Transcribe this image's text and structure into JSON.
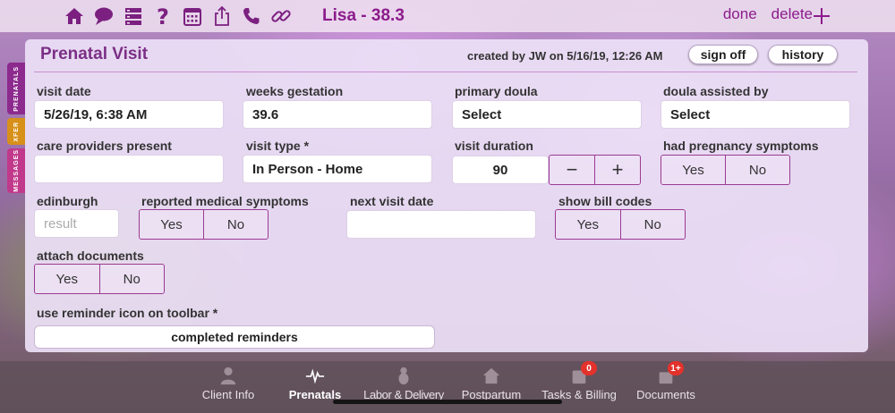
{
  "topbar": {
    "client_title": "Lisa - 38.3",
    "done_label": "done",
    "delete_label": "delete",
    "icons": [
      "home-icon",
      "chat-icon",
      "list-icon",
      "help-icon",
      "calendar-icon",
      "share-icon",
      "phone-icon",
      "link-icon",
      "plus-icon"
    ]
  },
  "side_tabs": [
    {
      "label": "PRENATALS",
      "color": "#8c2a8e"
    },
    {
      "label": "XFER",
      "color": "#d7901a"
    },
    {
      "label": "MESSAGES",
      "color": "#c1398b"
    }
  ],
  "panel": {
    "title": "Prenatal Visit",
    "created_by": "created by JW on 5/16/19, 12:26 AM",
    "sign_off_label": "sign off",
    "history_label": "history"
  },
  "form": {
    "visit_date": {
      "label": "visit date",
      "value": "5/26/19, 6:38 AM"
    },
    "weeks_gestation": {
      "label": "weeks gestation",
      "value": "39.6"
    },
    "primary_doula": {
      "label": "primary doula",
      "value": "Select"
    },
    "doula_assisted_by": {
      "label": "doula assisted by",
      "value": "Select"
    },
    "care_providers": {
      "label": "care providers present",
      "value": ""
    },
    "visit_type": {
      "label": "visit type *",
      "value": "In Person - Home"
    },
    "visit_duration": {
      "label": "visit duration",
      "value": "90",
      "minus": "−",
      "plus": "+"
    },
    "pregnancy_symptoms": {
      "label": "had pregnancy symptoms",
      "yes": "Yes",
      "no": "No"
    },
    "edinburgh": {
      "label": "edinburgh",
      "placeholder": "result"
    },
    "medical_symptoms": {
      "label": "reported medical symptoms",
      "yes": "Yes",
      "no": "No"
    },
    "next_visit_date": {
      "label": "next visit date",
      "value": ""
    },
    "bill_codes": {
      "label": "show bill codes",
      "yes": "Yes",
      "no": "No"
    },
    "attach_documents": {
      "label": "attach documents",
      "yes": "Yes",
      "no": "No"
    },
    "reminder": {
      "label": "use reminder icon on toolbar *",
      "button": "completed reminders"
    }
  },
  "bottom_nav": [
    {
      "label": "Client Info",
      "icon": "person-icon",
      "active": false,
      "badge": ""
    },
    {
      "label": "Prenatals",
      "icon": "heartbeat-icon",
      "active": true,
      "badge": ""
    },
    {
      "label": "Labor & Delivery",
      "icon": "baby-icon",
      "active": false,
      "badge": ""
    },
    {
      "label": "Postpartum",
      "icon": "house-icon",
      "active": false,
      "badge": ""
    },
    {
      "label": "Tasks & Billing",
      "icon": "tasks-icon",
      "active": false,
      "badge": "0"
    },
    {
      "label": "Documents",
      "icon": "documents-icon",
      "active": false,
      "badge": "1+"
    }
  ],
  "colors": {
    "accent": "#8c1c8c",
    "border": "#9b3a92",
    "badge": "#e3322b"
  }
}
